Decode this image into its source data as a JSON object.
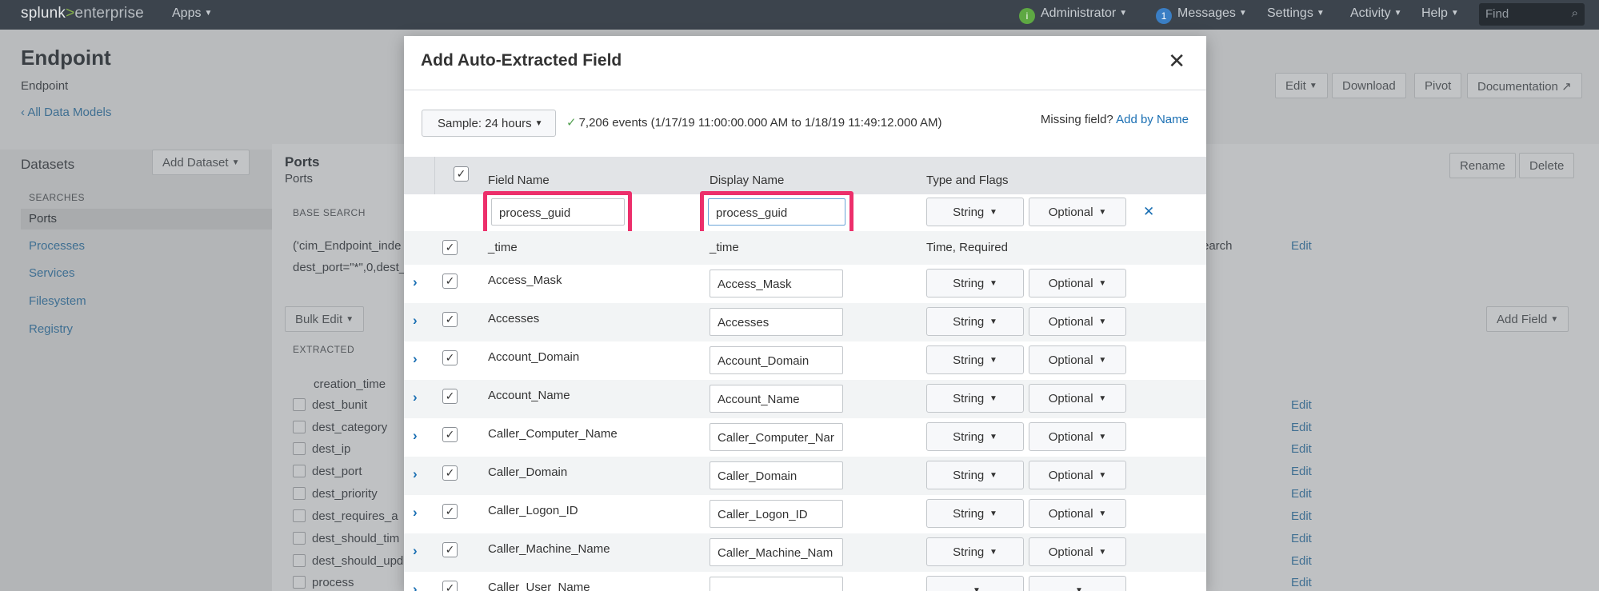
{
  "topbar": {
    "logo_main": "splunk",
    "logo_gt": ">",
    "logo_product": "enterprise",
    "apps": "Apps",
    "admin_badge": "i",
    "administrator": "Administrator",
    "messages_badge": "1",
    "messages": "Messages",
    "settings": "Settings",
    "activity": "Activity",
    "help": "Help",
    "find_placeholder": "Find"
  },
  "page": {
    "title": "Endpoint",
    "subtitle": "Endpoint",
    "back_link": "All Data Models",
    "buttons": {
      "edit": "Edit",
      "download": "Download",
      "pivot": "Pivot",
      "documentation": "Documentation"
    },
    "datasets_label": "Datasets",
    "add_dataset": "Add Dataset",
    "searches_label": "SEARCHES",
    "datasets": [
      "Ports",
      "Processes",
      "Services",
      "Filesystem",
      "Registry"
    ],
    "dataset_title": "Ports",
    "dataset_subtitle": "Ports",
    "rename": "Rename",
    "delete": "Delete",
    "base_search_label": "BASE SEARCH",
    "base_search_line1": "('cim_Endpoint_inde",
    "base_search_line2": "dest_port=\"*\",0,dest_",
    "search_suffix": "earch",
    "edit_link": "Edit",
    "bulk_edit": "Bulk Edit",
    "add_field": "Add Field",
    "extracted_label": "EXTRACTED",
    "creation_time": "creation_time",
    "fields": [
      "dest_bunit",
      "dest_category",
      "dest_ip",
      "dest_port",
      "dest_priority",
      "dest_requires_a",
      "dest_should_tim",
      "dest_should_upd",
      "process"
    ]
  },
  "modal": {
    "title": "Add Auto-Extracted Field",
    "sample_label": "Sample: 24 hours",
    "events_text": "7,206 events (1/17/19 11:00:00.000 AM to 1/18/19 11:49:12.000 AM)",
    "missing_text": "Missing field?",
    "add_by_name": "Add by Name",
    "columns": {
      "field_name": "Field Name",
      "display_name": "Display Name",
      "type_flags": "Type and Flags"
    },
    "new_field": {
      "field_name": "process_guid",
      "display_name": "process_guid",
      "type": "String",
      "flag": "Optional"
    },
    "time_row": {
      "field_name": "_time",
      "display_name": "_time",
      "type_flags": "Time, Required"
    },
    "rows": [
      {
        "field": "Access_Mask",
        "display": "Access_Mask",
        "type": "String",
        "flag": "Optional"
      },
      {
        "field": "Accesses",
        "display": "Accesses",
        "type": "String",
        "flag": "Optional"
      },
      {
        "field": "Account_Domain",
        "display": "Account_Domain",
        "type": "String",
        "flag": "Optional"
      },
      {
        "field": "Account_Name",
        "display": "Account_Name",
        "type": "String",
        "flag": "Optional"
      },
      {
        "field": "Caller_Computer_Name",
        "display": "Caller_Computer_Nar",
        "type": "String",
        "flag": "Optional"
      },
      {
        "field": "Caller_Domain",
        "display": "Caller_Domain",
        "type": "String",
        "flag": "Optional"
      },
      {
        "field": "Caller_Logon_ID",
        "display": "Caller_Logon_ID",
        "type": "String",
        "flag": "Optional"
      },
      {
        "field": "Caller_Machine_Name",
        "display": "Caller_Machine_Nam",
        "type": "String",
        "flag": "Optional"
      },
      {
        "field": "Caller_User_Name",
        "display": "",
        "type": "",
        "flag": ""
      }
    ],
    "highlight_color": "#ec2f6b",
    "link_color": "#1a6fb3"
  }
}
